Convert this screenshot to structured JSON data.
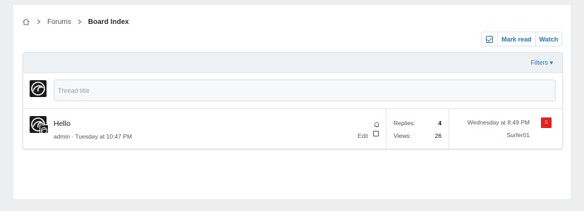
{
  "breadcrumb": {
    "home_icon": "home-icon",
    "items": [
      "Forums",
      "Board Index"
    ]
  },
  "actions": {
    "check_icon": "checkbox-icon",
    "mark_read": "Mark read",
    "watch": "Watch"
  },
  "filter_bar": {
    "filters_label": "Filters ▾"
  },
  "quick_thread": {
    "placeholder": "Thread title"
  },
  "threads": [
    {
      "title": "Hello",
      "meta": "admin · Tuesday at 10:47 PM",
      "edit_label": "Edit",
      "replies_label": "Replies:",
      "replies": "4",
      "views_label": "Views:",
      "views": "26",
      "last_date": "Wednesday at 8:49 PM",
      "last_user": "Surfer01",
      "last_avatar_letter": "S"
    }
  ],
  "colors": {
    "accent": "#2577b1",
    "last_avatar_bg": "#e02424"
  }
}
